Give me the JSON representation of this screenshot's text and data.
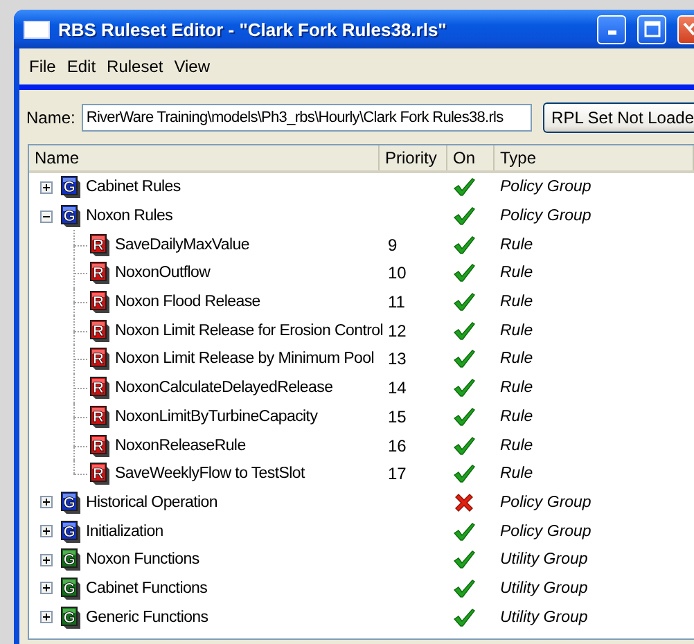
{
  "window": {
    "title": "RBS Ruleset Editor - \"Clark Fork Rules38.rls\""
  },
  "menu": [
    "File",
    "Edit",
    "Ruleset",
    "View"
  ],
  "name_field": {
    "label": "Name:",
    "value": "RiverWare Training\\models\\Ph3_rbs\\Hourly\\Clark Fork Rules38.rls"
  },
  "rpl_button": "RPL Set Not Loade",
  "table": {
    "columns": [
      "Name",
      "Priority",
      "On",
      "Type"
    ],
    "rows": [
      {
        "kind": "policy_group",
        "icon": "G",
        "name": "Cabinet Rules",
        "on": true,
        "type": "Policy Group",
        "expanded": false
      },
      {
        "kind": "policy_group",
        "icon": "G",
        "name": "Noxon Rules",
        "on": true,
        "type": "Policy Group",
        "expanded": true,
        "children": [
          {
            "kind": "rule",
            "icon": "R",
            "name": "SaveDailyMaxValue",
            "priority": "9",
            "on": true,
            "type": "Rule"
          },
          {
            "kind": "rule",
            "icon": "R",
            "name": "NoxonOutflow",
            "priority": "10",
            "on": true,
            "type": "Rule"
          },
          {
            "kind": "rule",
            "icon": "R",
            "name": "Noxon Flood Release",
            "priority": "11",
            "on": true,
            "type": "Rule"
          },
          {
            "kind": "rule",
            "icon": "R",
            "name": "Noxon Limit Release for Erosion Control",
            "priority": "12",
            "on": true,
            "type": "Rule"
          },
          {
            "kind": "rule",
            "icon": "R",
            "name": "Noxon Limit Release by Minimum Pool",
            "priority": "13",
            "on": true,
            "type": "Rule"
          },
          {
            "kind": "rule",
            "icon": "R",
            "name": "NoxonCalculateDelayedRelease",
            "priority": "14",
            "on": true,
            "type": "Rule"
          },
          {
            "kind": "rule",
            "icon": "R",
            "name": "NoxonLimitByTurbineCapacity",
            "priority": "15",
            "on": true,
            "type": "Rule"
          },
          {
            "kind": "rule",
            "icon": "R",
            "name": "NoxonReleaseRule",
            "priority": "16",
            "on": true,
            "type": "Rule"
          },
          {
            "kind": "rule",
            "icon": "R",
            "name": "SaveWeeklyFlow to TestSlot",
            "priority": "17",
            "on": true,
            "type": "Rule"
          }
        ]
      },
      {
        "kind": "policy_group",
        "icon": "G",
        "name": "Historical Operation",
        "on": false,
        "type": "Policy Group",
        "expanded": false
      },
      {
        "kind": "policy_group",
        "icon": "G",
        "name": "Initialization",
        "on": true,
        "type": "Policy Group",
        "expanded": false
      },
      {
        "kind": "utility_group",
        "icon": "G",
        "name": "Noxon Functions",
        "on": true,
        "type": "Utility Group",
        "expanded": false
      },
      {
        "kind": "utility_group",
        "icon": "G",
        "name": "Cabinet Functions",
        "on": true,
        "type": "Utility Group",
        "expanded": false
      },
      {
        "kind": "utility_group",
        "icon": "G",
        "name": "Generic Functions",
        "on": true,
        "type": "Utility Group",
        "expanded": false
      }
    ]
  }
}
